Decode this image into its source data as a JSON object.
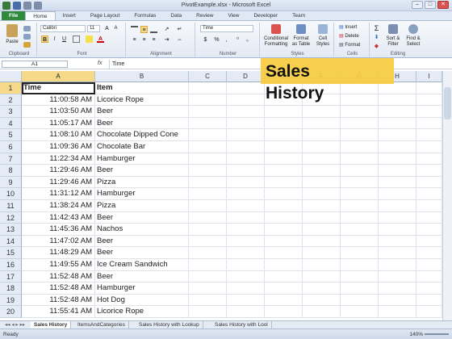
{
  "window": {
    "title": "PivotExample.xlsx - Microsoft Excel",
    "minimize": "–",
    "maximize": "□",
    "close": "✕"
  },
  "tabs": [
    "File",
    "Home",
    "Insert",
    "Page Layout",
    "Formulas",
    "Data",
    "Review",
    "View",
    "Developer",
    "Team"
  ],
  "ribbon": {
    "clipboard": {
      "paste": "Paste",
      "label": "Clipboard"
    },
    "font": {
      "name": "Calibri",
      "size": "11",
      "bold": "B",
      "italic": "I",
      "underline": "U",
      "label": "Font"
    },
    "alignment": {
      "label": "Alignment"
    },
    "number": {
      "format": "Time",
      "dollar": "$",
      "percent": "%",
      "comma": ",",
      "label": "Number"
    },
    "styles": {
      "conditional": "Conditional Formatting",
      "format_table": "Format as Table",
      "cell_styles": "Cell Styles",
      "label": "Styles"
    },
    "cells": {
      "insert": "Insert",
      "delete": "Delete",
      "format": "Format",
      "label": "Cells"
    },
    "editing": {
      "sum": "Σ",
      "sort": "Sort & Filter",
      "find": "Find & Select",
      "label": "Editing"
    }
  },
  "formula_bar": {
    "name_box": "A1",
    "fx": "fx",
    "value": "Time"
  },
  "columns": [
    "A",
    "B",
    "C",
    "D",
    "E",
    "F",
    "G",
    "H",
    "I"
  ],
  "rows": [
    {
      "n": "1",
      "time": "Time",
      "item": "Item"
    },
    {
      "n": "2",
      "time": "11:00:58 AM",
      "item": "Licorice Rope"
    },
    {
      "n": "3",
      "time": "11:03:50 AM",
      "item": "Beer"
    },
    {
      "n": "4",
      "time": "11:05:17 AM",
      "item": "Beer"
    },
    {
      "n": "5",
      "time": "11:08:10 AM",
      "item": "Chocolate Dipped Cone"
    },
    {
      "n": "6",
      "time": "11:09:36 AM",
      "item": "Chocolate Bar"
    },
    {
      "n": "7",
      "time": "11:22:34 AM",
      "item": "Hamburger"
    },
    {
      "n": "8",
      "time": "11:29:46 AM",
      "item": "Beer"
    },
    {
      "n": "9",
      "time": "11:29:46 AM",
      "item": "Pizza"
    },
    {
      "n": "10",
      "time": "11:31:12 AM",
      "item": "Hamburger"
    },
    {
      "n": "11",
      "time": "11:38:24 AM",
      "item": "Pizza"
    },
    {
      "n": "12",
      "time": "11:42:43 AM",
      "item": "Beer"
    },
    {
      "n": "13",
      "time": "11:45:36 AM",
      "item": "Nachos"
    },
    {
      "n": "14",
      "time": "11:47:02 AM",
      "item": "Beer"
    },
    {
      "n": "15",
      "time": "11:48:29 AM",
      "item": "Beer"
    },
    {
      "n": "16",
      "time": "11:49:55 AM",
      "item": "Ice Cream Sandwich"
    },
    {
      "n": "17",
      "time": "11:52:48 AM",
      "item": "Beer"
    },
    {
      "n": "18",
      "time": "11:52:48 AM",
      "item": "Hamburger"
    },
    {
      "n": "19",
      "time": "11:52:48 AM",
      "item": "Hot Dog"
    },
    {
      "n": "20",
      "time": "11:55:41 AM",
      "item": "Licorice Rope"
    }
  ],
  "callout": {
    "line1": "Sales",
    "line2": "History"
  },
  "sheet_tabs": [
    "Sales History",
    "ItemsAndCategories",
    "Sales History with Lookup",
    "Sales History with Lool"
  ],
  "status": {
    "ready": "Ready",
    "zoom": "140%"
  },
  "colors": {
    "callout": "#f7cc3e",
    "file_tab": "#2f8a3b",
    "selected_header": "#f6d889"
  }
}
